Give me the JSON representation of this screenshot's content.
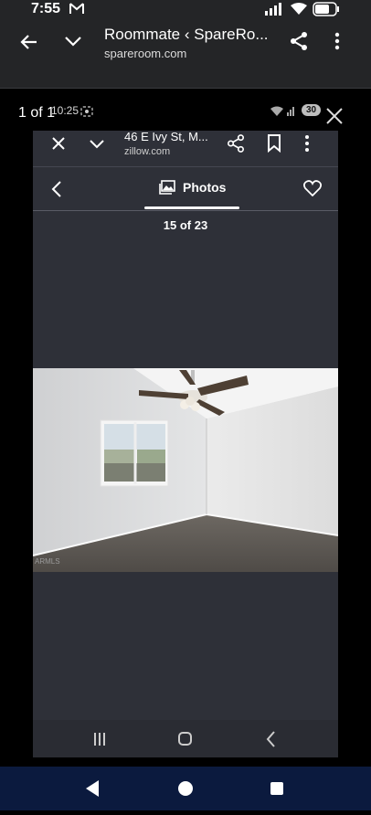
{
  "status": {
    "time": "7:55",
    "mail_icon": "gmail-icon"
  },
  "outer_toolbar": {
    "title": "Roommate ‹ SpareRo...",
    "url": "spareroom.com"
  },
  "viewer": {
    "page_counter": "1 of 1"
  },
  "inner": {
    "status_time": "10:25",
    "battery_badge": "30",
    "toolbar": {
      "title": "46 E Ivy St, M...",
      "url": "zillow.com"
    },
    "photos_tab_label": "Photos",
    "photo_count": "15 of 23",
    "watermark": "ARMLS"
  },
  "colors": {
    "chrome": "#242527",
    "inner_bg": "#2e3038",
    "nav": "#0b1a3e"
  }
}
